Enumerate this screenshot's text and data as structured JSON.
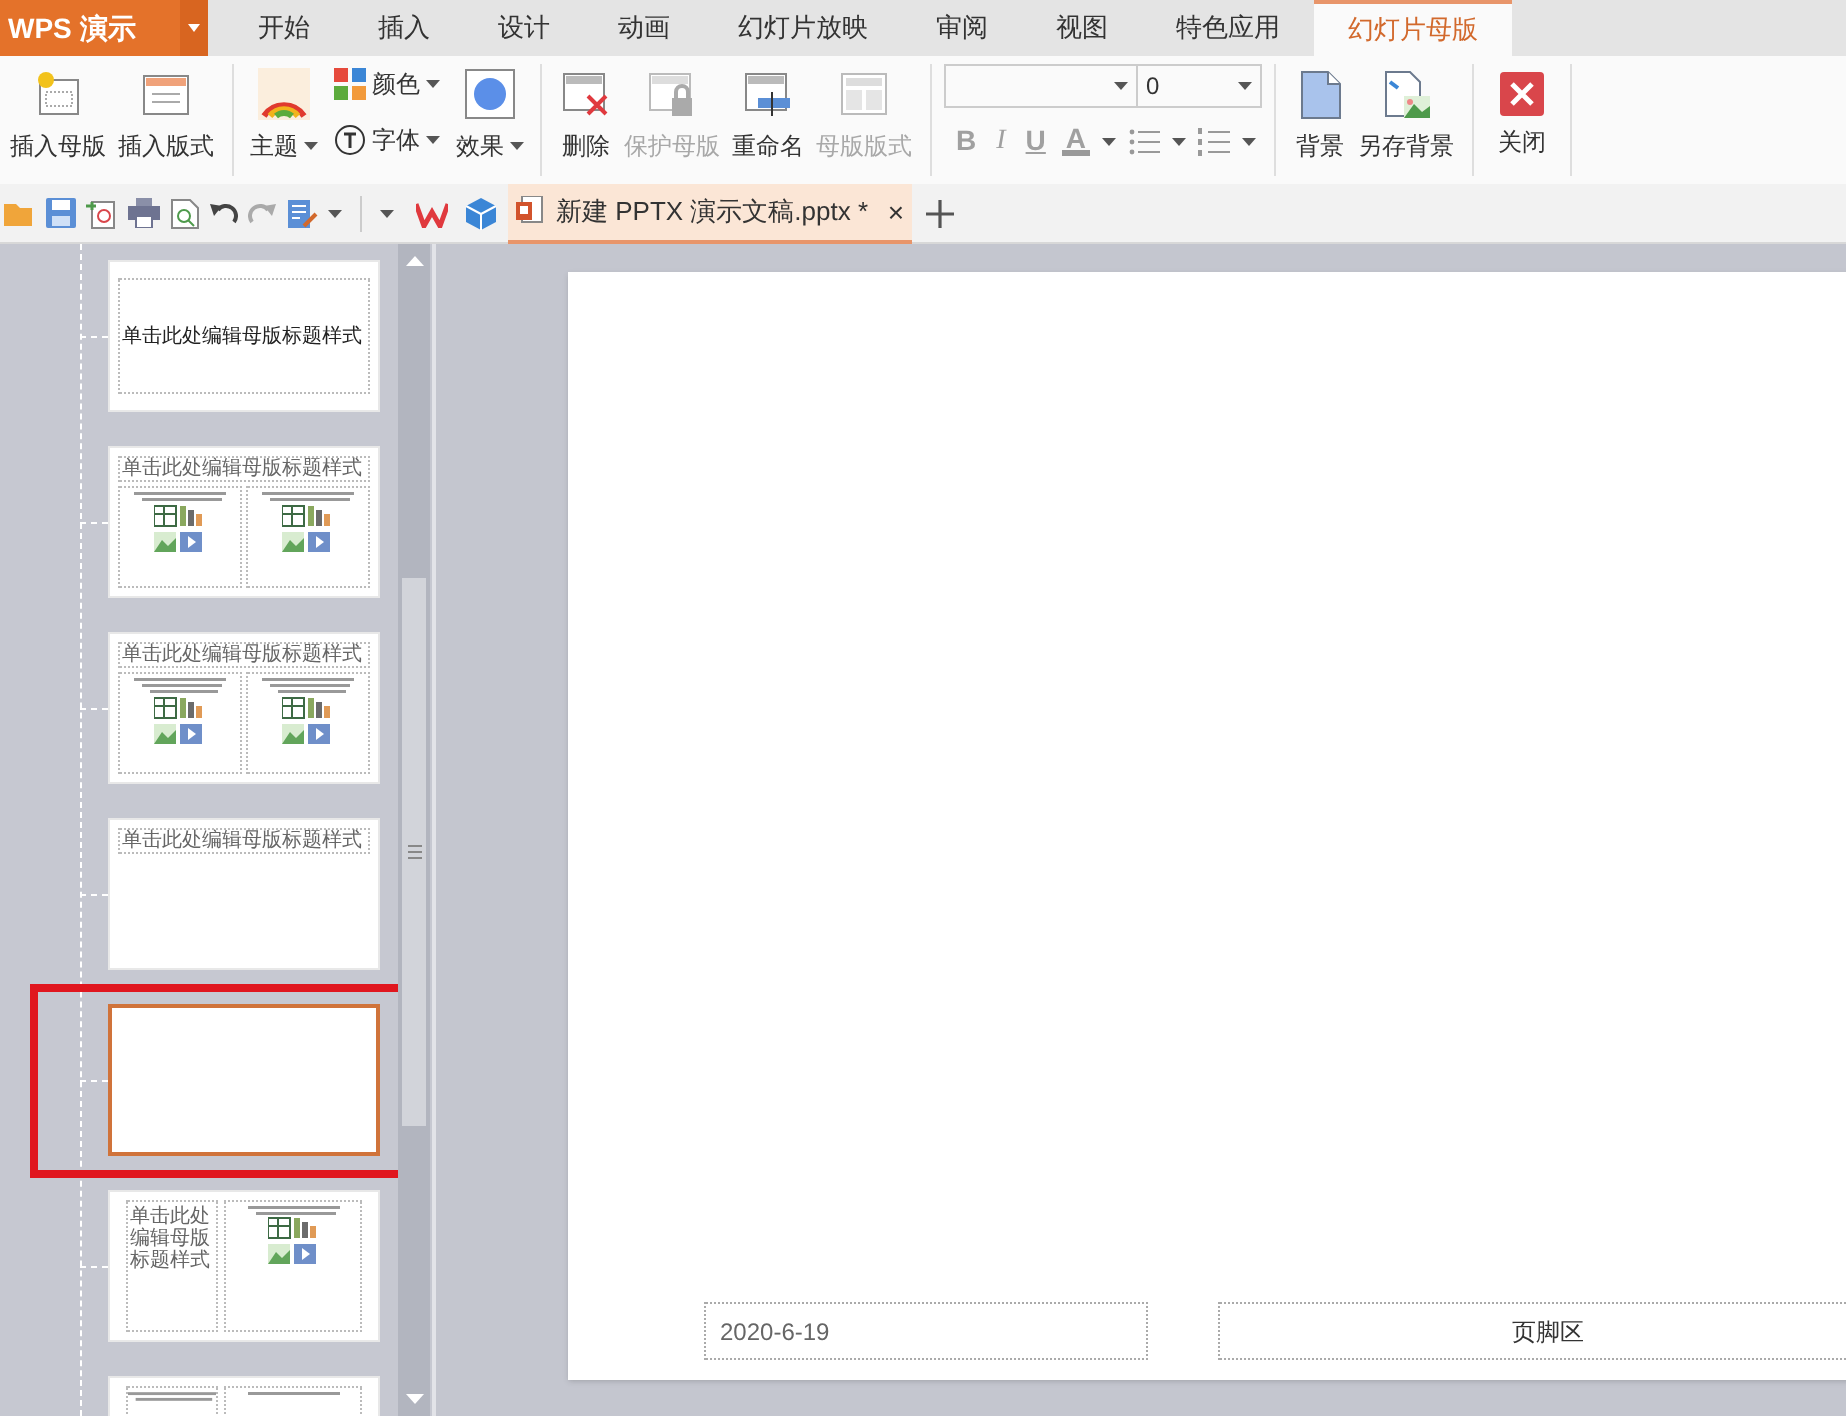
{
  "app": {
    "name": "WPS 演示"
  },
  "menu_tabs": [
    {
      "label": "开始",
      "selected": false
    },
    {
      "label": "插入",
      "selected": false
    },
    {
      "label": "设计",
      "selected": false
    },
    {
      "label": "动画",
      "selected": false
    },
    {
      "label": "幻灯片放映",
      "selected": false
    },
    {
      "label": "审阅",
      "selected": false
    },
    {
      "label": "视图",
      "selected": false
    },
    {
      "label": "特色应用",
      "selected": false
    },
    {
      "label": "幻灯片母版",
      "selected": true
    }
  ],
  "ribbon": {
    "master": [
      {
        "label": "插入母版",
        "kind": "insert-master"
      },
      {
        "label": "插入版式",
        "kind": "insert-layout"
      }
    ],
    "theme": {
      "theme": "主题",
      "colors": "颜色",
      "font": "字体",
      "effect": "效果"
    },
    "edit": [
      {
        "label": "删除",
        "kind": "delete",
        "disabled": false
      },
      {
        "label": "保护母版",
        "kind": "protect",
        "disabled": true
      },
      {
        "label": "重命名",
        "kind": "rename",
        "disabled": false
      },
      {
        "label": "母版版式",
        "kind": "layout",
        "disabled": true
      }
    ],
    "font": {
      "size": "0",
      "format": [
        {
          "label": "B",
          "kind": "bold",
          "disabled": true
        },
        {
          "label": "I",
          "kind": "italic",
          "disabled": true
        },
        {
          "label": "U",
          "kind": "underline",
          "disabled": true
        },
        {
          "label": "A",
          "kind": "color",
          "disabled": true
        }
      ]
    },
    "background": [
      {
        "label": "背景",
        "kind": "background"
      },
      {
        "label": "另存背景",
        "kind": "save-background"
      }
    ],
    "close": {
      "label": "关闭"
    }
  },
  "document_tab": {
    "title": "新建 PPTX 演示文稿.pptx *",
    "close": "×",
    "selected": true
  },
  "thumbnails": [
    {
      "kind": "title",
      "title": "单击此处编辑母版标题样式",
      "selected": false,
      "highlighted": false
    },
    {
      "kind": "two-content",
      "title": "单击此处编辑母版标题样式",
      "selected": false,
      "highlighted": false
    },
    {
      "kind": "comparison",
      "title": "单击此处编辑母版标题样式",
      "selected": false,
      "highlighted": false
    },
    {
      "kind": "title-only",
      "title": "单击此处编辑母版标题样式",
      "selected": false,
      "highlighted": false
    },
    {
      "kind": "blank",
      "selected": true,
      "highlighted": true
    },
    {
      "kind": "content-caption",
      "title": "单击此处编辑母版标题样式",
      "selected": false,
      "highlighted": false
    },
    {
      "kind": "picture-caption",
      "selected": false,
      "highlighted": false
    }
  ],
  "slide": {
    "date": "2020-6-19",
    "footer": "页脚区"
  }
}
